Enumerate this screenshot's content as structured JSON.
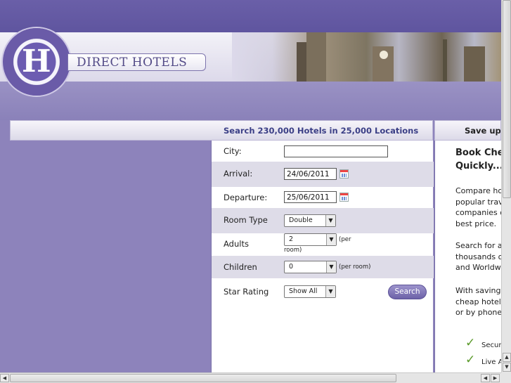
{
  "brand": {
    "name": "DIRECT HOTELS",
    "logo_letter": "H"
  },
  "search": {
    "heading": "Search 230,000 Hotels in 25,000 Locations",
    "city_label": "City:",
    "city_value": "",
    "arrival_label": "Arrival:",
    "arrival_value": "24/06/2011",
    "departure_label": "Departure:",
    "departure_value": "25/06/2011",
    "room_type_label": "Room Type",
    "room_type_value": "Double",
    "adults_label": "Adults",
    "adults_value": "2",
    "adults_note_1": "(per",
    "adults_note_2": "room)",
    "children_label": "Children",
    "children_value": "0",
    "children_note": "(per room)",
    "star_label": "Star Rating",
    "star_value": "Show All",
    "button": "Search"
  },
  "promo": {
    "heading": "Save up t",
    "title_1": "Book Chea",
    "title_2": "Quickly...",
    "p1": [
      "Compare hot",
      "popular trave",
      "companies o",
      "best price."
    ],
    "p2": [
      "Search for av",
      "thousands of",
      "and Worldwic"
    ],
    "p3": [
      "With savings",
      "cheap hotels",
      "or by phone!"
    ],
    "checks": [
      "Secure",
      "Live A"
    ]
  },
  "colors": {
    "accent": "#6a5fa8",
    "heading_text": "#3b3f86",
    "check": "#5a9a2a"
  }
}
